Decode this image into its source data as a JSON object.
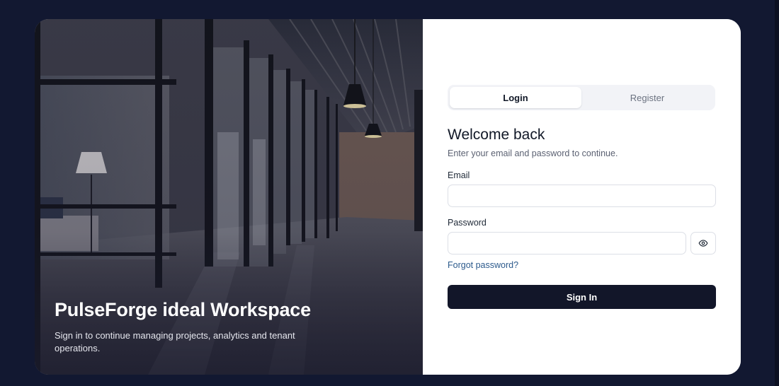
{
  "colors": {
    "page_background": "#121831",
    "primary_button": "#121629",
    "link": "#2c5a8c"
  },
  "hero": {
    "title": "PulseForge ideal Workspace",
    "subtitle": "Sign in to continue managing projects, analytics and tenant operations."
  },
  "tabs": [
    {
      "label": "Login",
      "active": true
    },
    {
      "label": "Register",
      "active": false
    }
  ],
  "form": {
    "heading": "Welcome back",
    "subheading": "Enter your email and password to continue.",
    "email_label": "Email",
    "email_value": "",
    "password_label": "Password",
    "password_value": "",
    "toggle_icon": "eye-icon",
    "forgot_link": "Forgot password?",
    "submit_label": "Sign In"
  }
}
